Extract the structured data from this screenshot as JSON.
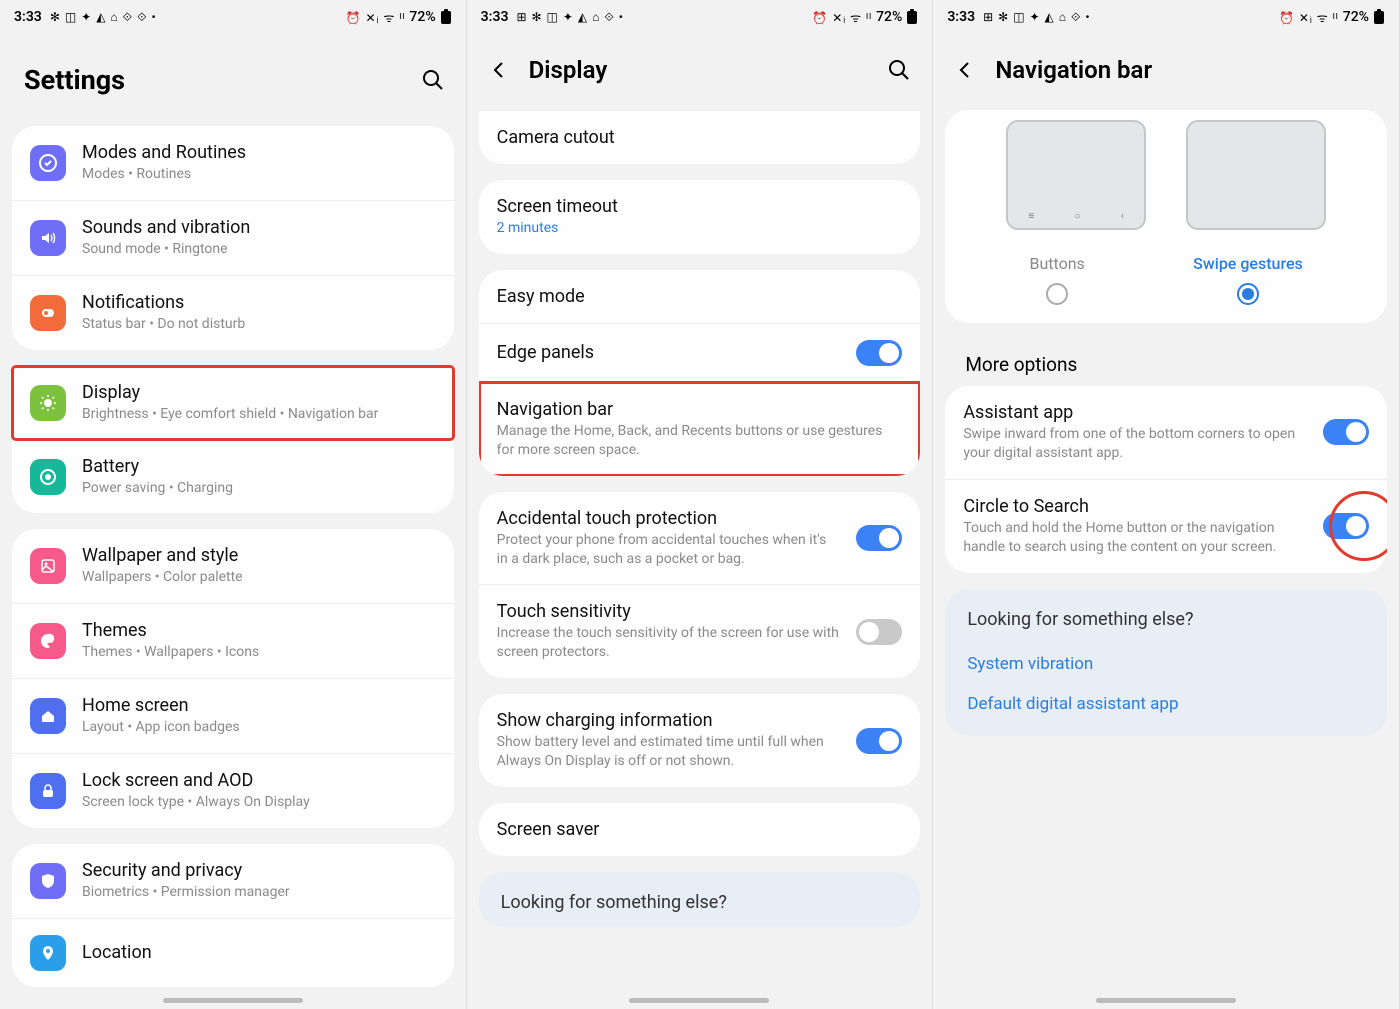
{
  "status": {
    "time": "3:33",
    "icons_left": "✻ ◫ ✦ ◭ ⌂ ⟐ ⟐ •",
    "icons_left_b": "⊞ ✻ ◫ ✦ ◭ ⌂ ⟐ •",
    "icons_left_c": "⊞ ✻ ◫ ✦ ◭ ⌂ ⟐ •",
    "icons_right": "⏰ ✕ᵢ ᯤ ᴵᴵ",
    "battery": "72%"
  },
  "panel1": {
    "title": "Settings",
    "items": [
      {
        "label": "Modes and Routines",
        "sub": "Modes  •  Routines",
        "color": "#6e6ef6",
        "icon": "target"
      },
      {
        "label": "Sounds and vibration",
        "sub": "Sound mode  •  Ringtone",
        "color": "#6e6ef6",
        "icon": "sound"
      },
      {
        "label": "Notifications",
        "sub": "Status bar  •  Do not disturb",
        "color": "#f26b3a",
        "icon": "bell"
      },
      {
        "label": "Display",
        "sub": "Brightness  •  Eye comfort shield  •  Navigation bar",
        "color": "#7cc23e",
        "icon": "sun",
        "highlight": true
      },
      {
        "label": "Battery",
        "sub": "Power saving  •  Charging",
        "color": "#17b79a",
        "icon": "battery"
      },
      {
        "label": "Wallpaper and style",
        "sub": "Wallpapers  •  Color palette",
        "color": "#f65a8a",
        "icon": "image"
      },
      {
        "label": "Themes",
        "sub": "Themes  •  Wallpapers  •  Icons",
        "color": "#f65a8a",
        "icon": "palette"
      },
      {
        "label": "Home screen",
        "sub": "Layout  •  App icon badges",
        "color": "#4f6ef0",
        "icon": "home"
      },
      {
        "label": "Lock screen and AOD",
        "sub": "Screen lock type  •  Always On Display",
        "color": "#4f6ef0",
        "icon": "lock"
      },
      {
        "label": "Security and privacy",
        "sub": "Biometrics  •  Permission manager",
        "color": "#6e6ef6",
        "icon": "shield"
      },
      {
        "label": "Location",
        "sub": "",
        "color": "#2a9ee8",
        "icon": "pin"
      }
    ]
  },
  "panel2": {
    "title": "Display",
    "group1": [
      {
        "label": "Camera cutout"
      }
    ],
    "group2": [
      {
        "label": "Screen timeout",
        "sub": "2 minutes",
        "sub_blue": true
      }
    ],
    "group3": [
      {
        "label": "Easy mode"
      },
      {
        "label": "Edge panels",
        "toggle": "on"
      },
      {
        "label": "Navigation bar",
        "sub": "Manage the Home, Back, and Recents buttons or use gestures for more screen space.",
        "highlight": true
      }
    ],
    "group4": [
      {
        "label": "Accidental touch protection",
        "sub": "Protect your phone from accidental touches when it's in a dark place, such as a pocket or bag.",
        "toggle": "on"
      },
      {
        "label": "Touch sensitivity",
        "sub": "Increase the touch sensitivity of the screen for use with screen protectors.",
        "toggle": "off"
      }
    ],
    "group5": [
      {
        "label": "Show charging information",
        "sub": "Show battery level and estimated time until full when Always On Display is off or not shown.",
        "toggle": "on"
      }
    ],
    "group6": [
      {
        "label": "Screen saver"
      }
    ],
    "looking": "Looking for something else?"
  },
  "panel3": {
    "title": "Navigation bar",
    "opt_buttons": "Buttons",
    "opt_swipe": "Swipe gestures",
    "more": "More options",
    "items": [
      {
        "label": "Assistant app",
        "sub": "Swipe inward from one of the bottom corners to open your digital assistant app.",
        "toggle": "on"
      },
      {
        "label": "Circle to Search",
        "sub": "Touch and hold the Home button or the navigation handle to search using the content on your screen.",
        "toggle": "on",
        "circle": true
      }
    ],
    "looking": "Looking for something else?",
    "link1": "System vibration",
    "link2": "Default digital assistant app"
  }
}
